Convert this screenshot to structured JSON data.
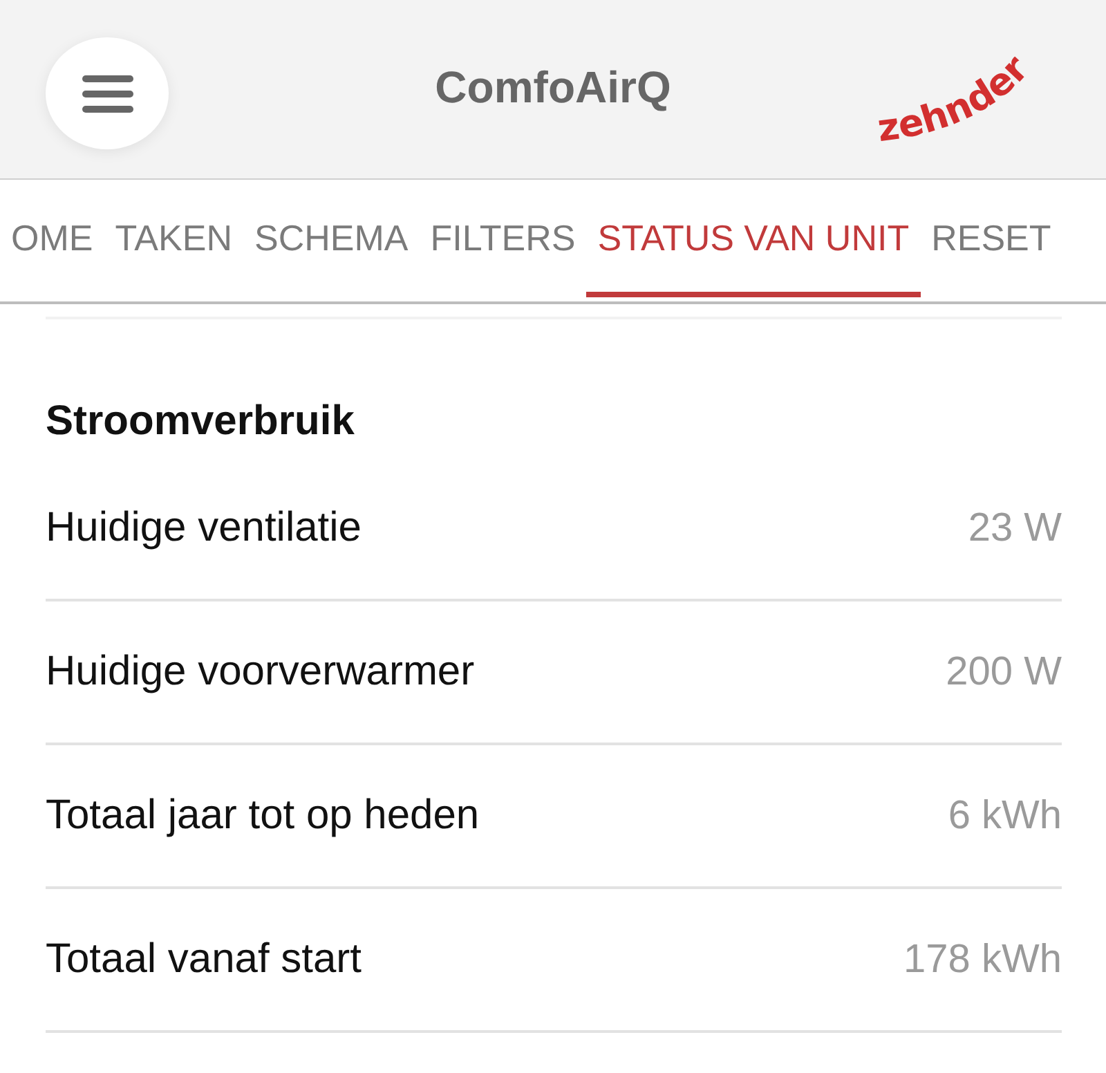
{
  "header": {
    "title": "ComfoAirQ",
    "logo": "zehnder"
  },
  "tabs": [
    {
      "label": "OME",
      "selected": false
    },
    {
      "label": "TAKEN",
      "selected": false
    },
    {
      "label": "SCHEMA",
      "selected": false
    },
    {
      "label": "FILTERS",
      "selected": false
    },
    {
      "label": "STATUS VAN UNIT",
      "selected": true
    },
    {
      "label": "RESET",
      "selected": false
    }
  ],
  "section": {
    "title": "Stroomverbruik",
    "rows": [
      {
        "label": "Huidige ventilatie",
        "value": "23 W"
      },
      {
        "label": "Huidige voorverwarmer",
        "value": "200 W"
      },
      {
        "label": "Totaal jaar tot op heden",
        "value": "6 kWh"
      },
      {
        "label": "Totaal vanaf start",
        "value": "178 kWh"
      }
    ]
  }
}
